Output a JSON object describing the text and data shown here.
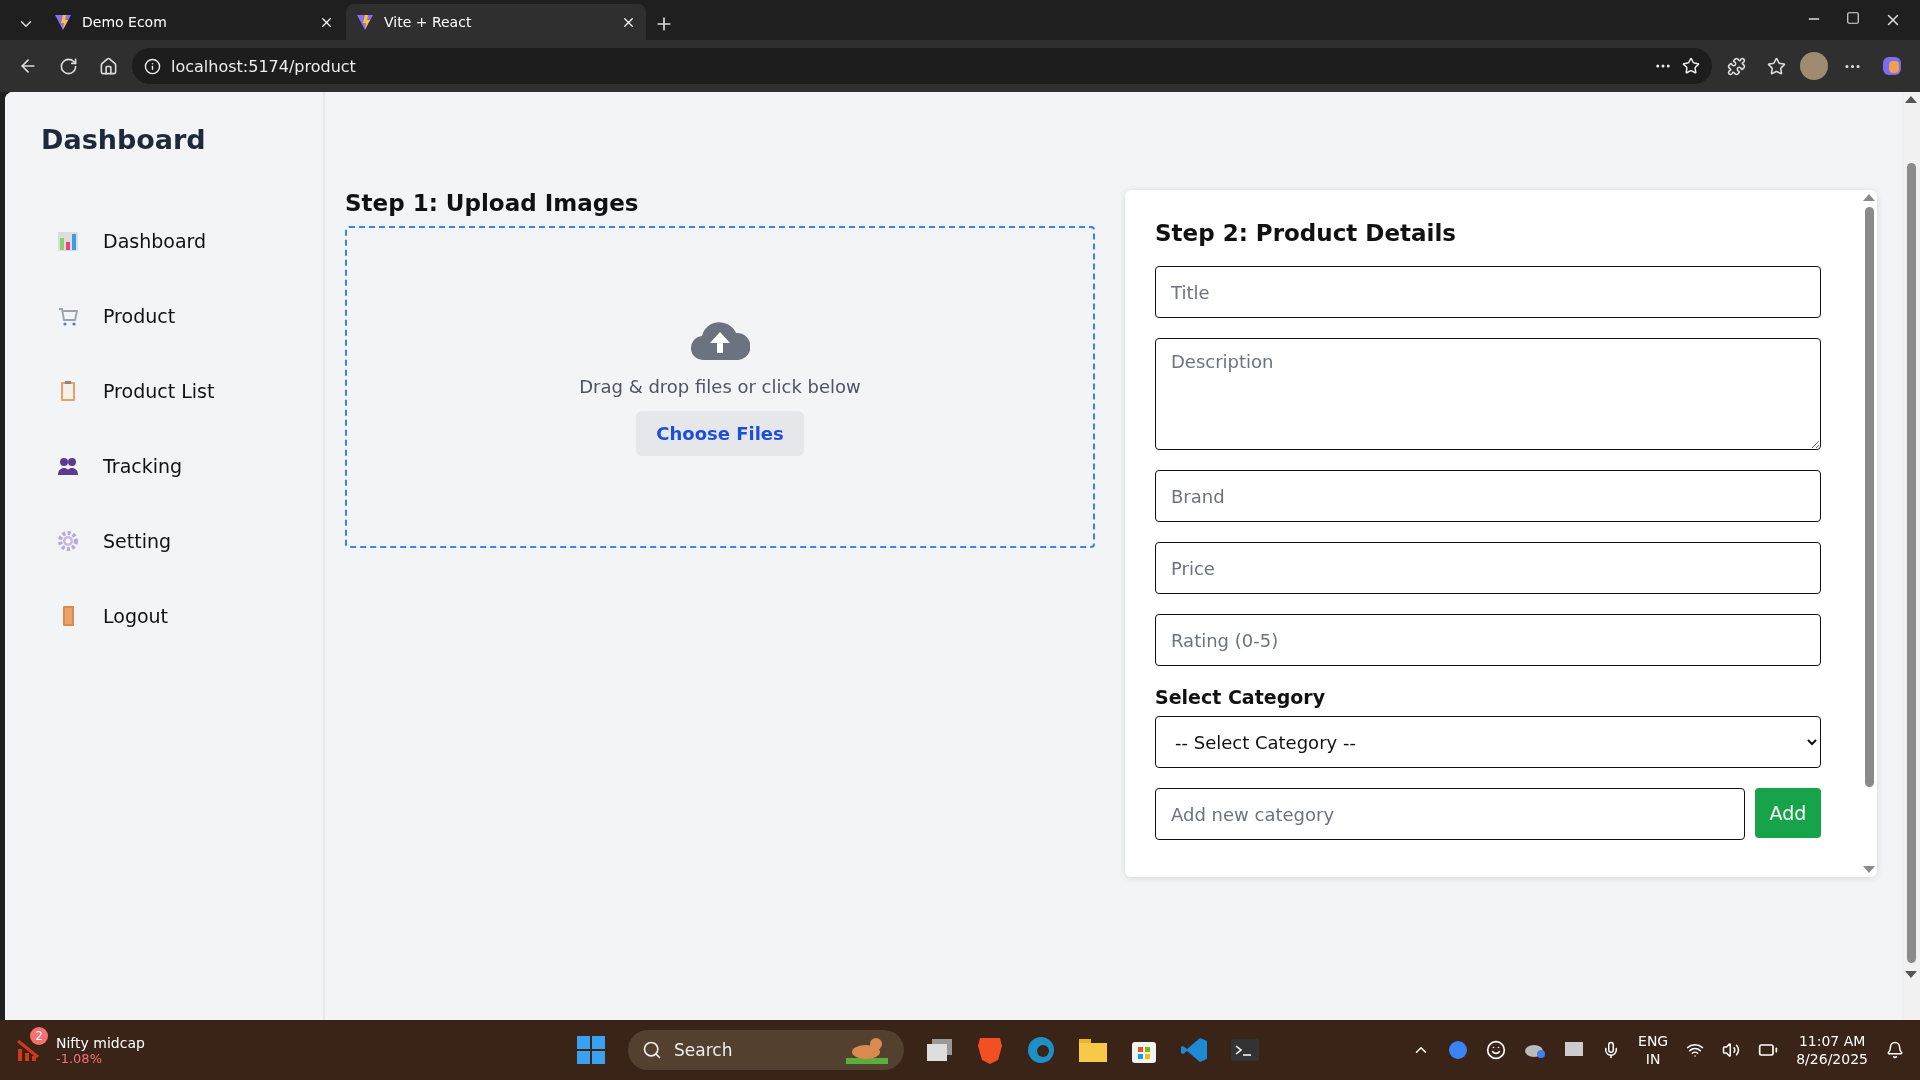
{
  "browser": {
    "tabs": [
      {
        "title": "Demo Ecom",
        "selected": false
      },
      {
        "title": "Vite + React",
        "selected": true
      }
    ],
    "address": "localhost:5174/product"
  },
  "sidebar": {
    "title": "Dashboard",
    "items": [
      {
        "label": "Dashboard"
      },
      {
        "label": "Product"
      },
      {
        "label": "Product List"
      },
      {
        "label": "Tracking"
      },
      {
        "label": "Setting"
      },
      {
        "label": "Logout"
      }
    ]
  },
  "upload": {
    "heading": "Step 1: Upload Images",
    "hint": "Drag & drop files or click below",
    "button": "Choose Files"
  },
  "details": {
    "heading": "Step 2: Product Details",
    "fields": [
      {
        "kind": "input",
        "placeholder": "Title"
      },
      {
        "kind": "textarea",
        "placeholder": "Description"
      },
      {
        "kind": "input",
        "placeholder": "Brand"
      },
      {
        "kind": "input",
        "placeholder": "Price"
      },
      {
        "kind": "input",
        "placeholder": "Rating (0-5)"
      }
    ],
    "category_label": "Select Category",
    "category_select": "-- Select Category --",
    "new_category": {
      "placeholder": "Add new category"
    },
    "add_button": "Add"
  },
  "taskbar": {
    "widget": {
      "badge": "2",
      "title": "Nifty midcap",
      "value": "-1.08%"
    },
    "search": "Search",
    "language": [
      "ENG",
      "IN"
    ],
    "time": "11:07 AM",
    "date": "8/26/2025"
  }
}
